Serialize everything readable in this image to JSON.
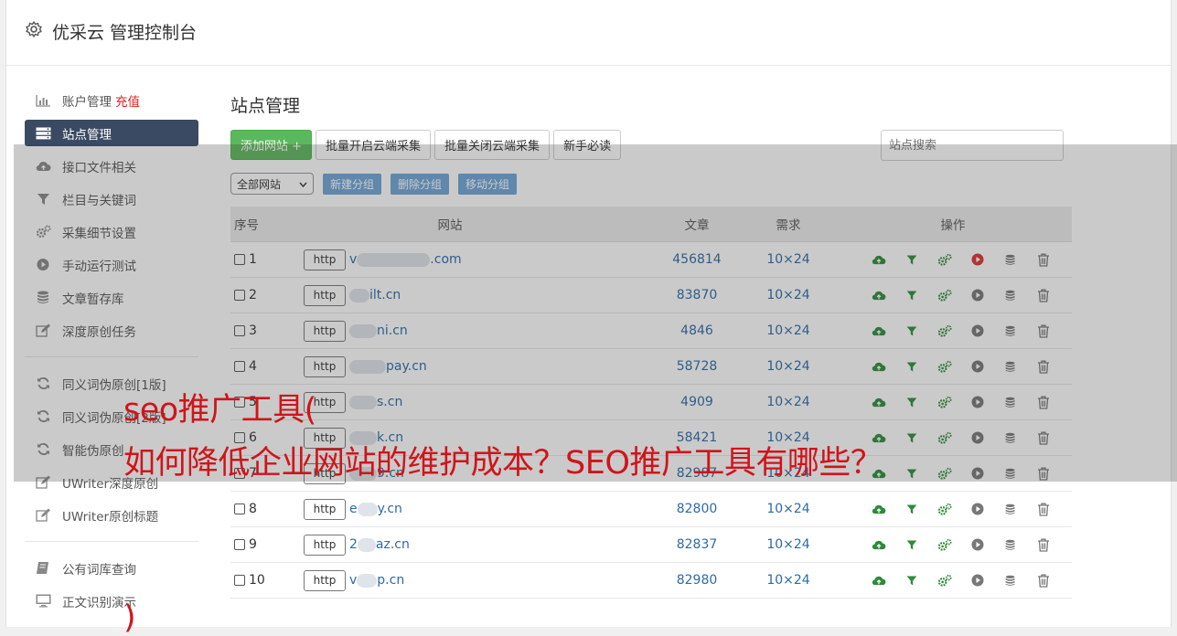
{
  "app": {
    "title": "优采云 管理控制台"
  },
  "sidebar": {
    "items": [
      {
        "label": "账户管理",
        "icon": "bar-chart-icon",
        "extra": "充值"
      },
      {
        "label": "站点管理",
        "icon": "server-icon",
        "active": true
      },
      {
        "label": "接口文件相关",
        "icon": "cloud-upload-icon"
      },
      {
        "label": "栏目与关键词",
        "icon": "filter-icon"
      },
      {
        "label": "采集细节设置",
        "icon": "gears-icon"
      },
      {
        "label": "手动运行测试",
        "icon": "play-circle-icon"
      },
      {
        "label": "文章暂存库",
        "icon": "database-icon"
      },
      {
        "label": "深度原创任务",
        "icon": "edit-icon"
      }
    ],
    "items2": [
      {
        "label": "同义词伪原创[1版]",
        "icon": "refresh-icon"
      },
      {
        "label": "同义词伪原创[2版]",
        "icon": "refresh-icon"
      },
      {
        "label": "智能伪原创",
        "icon": "refresh-icon"
      },
      {
        "label": "UWriter深度原创",
        "icon": "edit-icon"
      },
      {
        "label": "UWriter原创标题",
        "icon": "edit-icon"
      }
    ],
    "items3": [
      {
        "label": "公有词库查询",
        "icon": "book-icon"
      },
      {
        "label": "正文识别演示",
        "icon": "monitor-icon"
      }
    ]
  },
  "main": {
    "heading": "站点管理",
    "toolbar": {
      "add": "添加网站 +",
      "batch_on": "批量开启云端采集",
      "batch_off": "批量关闭云端采集",
      "guide": "新手必读"
    },
    "search": {
      "placeholder": "站点搜索"
    },
    "group_select": "全部网站",
    "group_buttons": {
      "new": "新建分组",
      "delete": "删除分组",
      "move": "移动分组"
    },
    "table": {
      "headers": {
        "no": "序号",
        "site": "网站",
        "articles": "文章",
        "demand": "需求",
        "ops": "操作"
      },
      "rows": [
        {
          "no": "1",
          "scheme": "http",
          "domain_prefix": "v",
          "domain": ".com",
          "articles": "456814",
          "demand": "10×24",
          "running": true
        },
        {
          "no": "2",
          "scheme": "http",
          "domain_prefix": "",
          "domain": "ilt.cn",
          "articles": "83870",
          "demand": "10×24"
        },
        {
          "no": "3",
          "scheme": "http",
          "domain_prefix": "",
          "domain": "ni.cn",
          "articles": "4846",
          "demand": "10×24"
        },
        {
          "no": "4",
          "scheme": "http",
          "domain_prefix": "",
          "domain": "pay.cn",
          "articles": "58728",
          "demand": "10×24"
        },
        {
          "no": "5",
          "scheme": "http",
          "domain_prefix": "",
          "domain": "s.cn",
          "articles": "4909",
          "demand": "10×24"
        },
        {
          "no": "6",
          "scheme": "http",
          "domain_prefix": "",
          "domain": "k.cn",
          "articles": "58421",
          "demand": "10×24"
        },
        {
          "no": "7",
          "scheme": "http",
          "domain_prefix": "",
          "domain": "9.cn",
          "articles": "82987",
          "demand": "10×24"
        },
        {
          "no": "8",
          "scheme": "http",
          "domain_prefix": "e",
          "domain": "y.cn",
          "articles": "82800",
          "demand": "10×24"
        },
        {
          "no": "9",
          "scheme": "http",
          "domain_prefix": "2",
          "domain": "az.cn",
          "articles": "82837",
          "demand": "10×24"
        },
        {
          "no": "10",
          "scheme": "http",
          "domain_prefix": "v",
          "domain": "p.cn",
          "articles": "82980",
          "demand": "10×24"
        }
      ]
    }
  },
  "overlay": {
    "line1": "seo推广工具(",
    "line2": "如何降低企业网站的维护成本？SEO推广工具有哪些？",
    "line3": ")"
  },
  "colors": {
    "accent": "#3b4a63",
    "green": "#5cb85c",
    "link": "#2d6aa8",
    "overlay_text": "#d0141b",
    "run": "#e03030"
  }
}
